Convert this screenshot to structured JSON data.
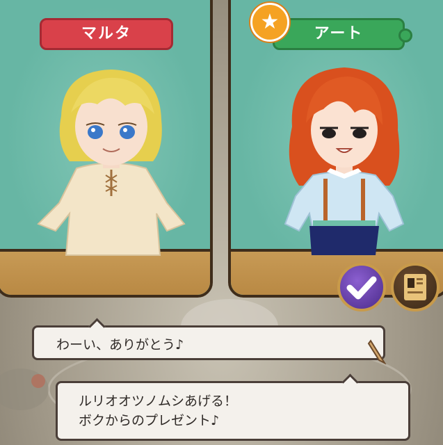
{
  "characters": {
    "left": {
      "name": "マルタ"
    },
    "right": {
      "name": "アート",
      "favorite_icon": "star-icon"
    }
  },
  "dialogue": {
    "npc_line": "わーい、ありがとう♪",
    "player_line_1": "ルリオオツノムシあげる！",
    "player_line_2": "ボクからのプレゼント♪"
  },
  "buttons": {
    "confirm_icon": "check-icon",
    "menu_icon": "book-icon"
  },
  "colors": {
    "panel_bg": "#67b6a4",
    "left_tag": "#d9414a",
    "right_tag": "#3aa75a",
    "star": "#f5a223"
  }
}
